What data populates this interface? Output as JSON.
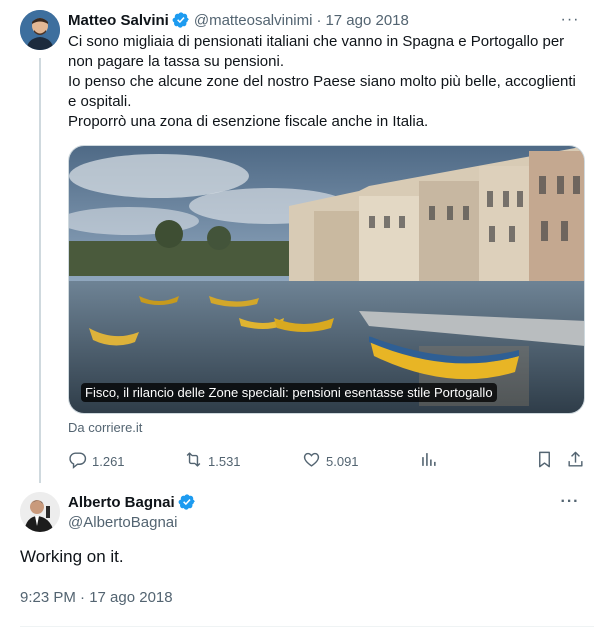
{
  "tweet": {
    "author_name": "Matteo Salvini",
    "handle": "@matteosalvinimi",
    "date": "17 ago 2018",
    "text_lines": [
      "Ci sono migliaia di pensionati italiani che vanno in Spagna e Portogallo per non pagare la tassa su pensioni.",
      "Io penso che alcune zone del nostro Paese siano molto più belle, accoglienti e ospitali.",
      "Proporrò una zona di esenzione fiscale anche in Italia."
    ],
    "card": {
      "caption": "Fisco, il rilancio delle Zone speciali: pensioni esentasse stile Portogallo",
      "source": "Da corriere.it"
    },
    "stats": {
      "replies": "1.261",
      "retweets": "1.531",
      "likes": "5.091"
    }
  },
  "reply": {
    "author_name": "Alberto Bagnai",
    "handle": "@AlbertoBagnai",
    "text": "Working on it.",
    "timestamp": "9:23 PM · 17 ago 2018"
  },
  "icons": {
    "verified": "verified-badge-icon",
    "more": "more-icon",
    "reply": "reply-icon",
    "retweet": "retweet-icon",
    "like": "heart-icon",
    "views": "views-icon",
    "bookmark": "bookmark-icon",
    "share": "share-icon"
  },
  "colors": {
    "text": "#0f1419",
    "muted": "#536471",
    "verified": "#1d9bf0",
    "thread_line": "#cfd9de"
  }
}
